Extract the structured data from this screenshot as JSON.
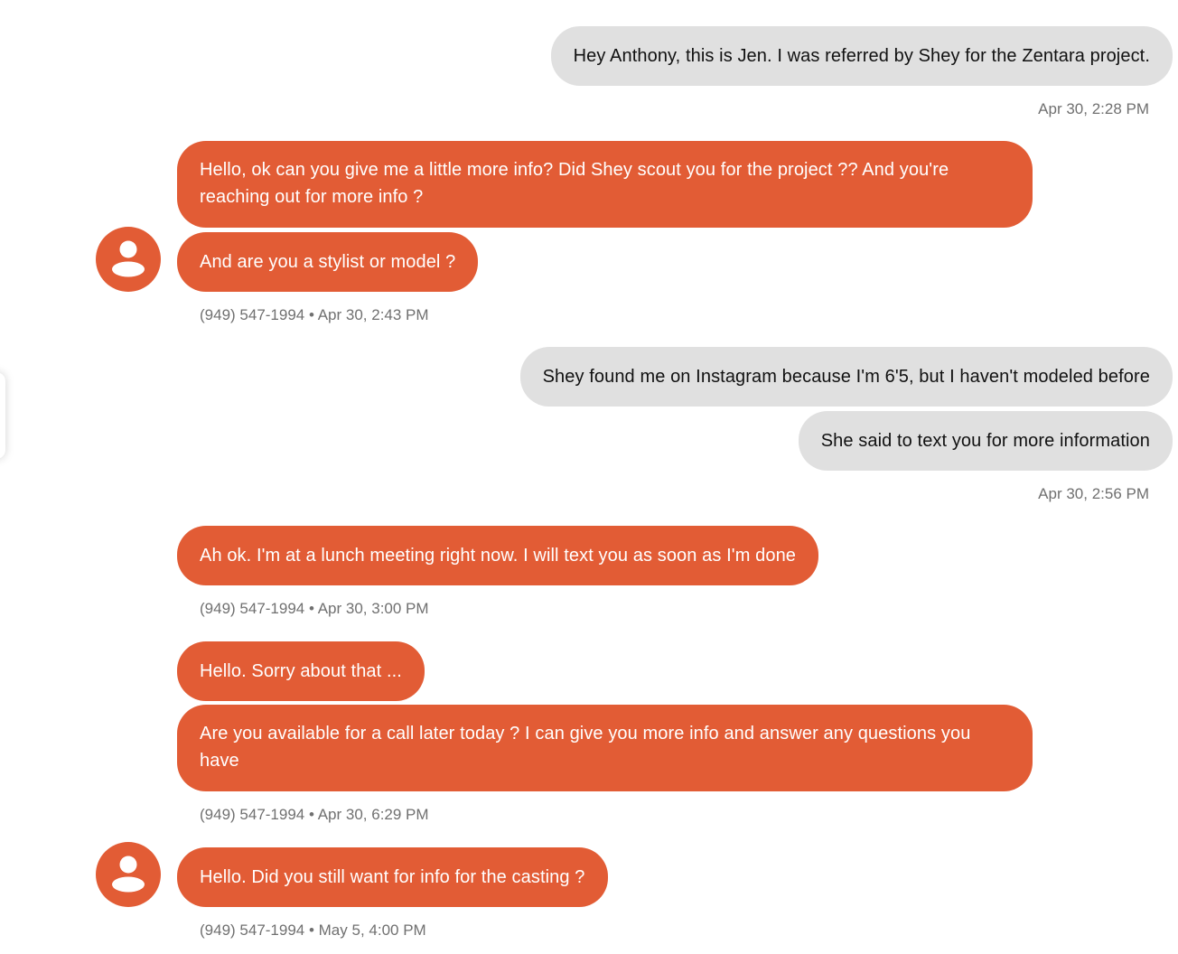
{
  "conversation": {
    "messages": [
      {
        "direction": "outgoing",
        "text": "Hey Anthony, this is Jen. I was referred by Shey for the Zentara project."
      },
      {
        "direction": "incoming",
        "text": "Hello, ok can you give me a little more info? Did Shey scout you for the project ?? And you're reaching out for more info ?"
      },
      {
        "direction": "incoming",
        "text": "And are you a stylist or model ?"
      },
      {
        "direction": "outgoing",
        "text": "Shey found me on Instagram because I'm 6'5, but I haven't modeled before"
      },
      {
        "direction": "outgoing",
        "text": "She said to text you for more information"
      },
      {
        "direction": "incoming",
        "text": "Ah ok. I'm at a lunch meeting right now. I will text you as soon as I'm done"
      },
      {
        "direction": "incoming",
        "text": "Hello. Sorry about that ..."
      },
      {
        "direction": "incoming",
        "text": "Are you available for a call later today ? I can give you more info and answer any questions you have"
      },
      {
        "direction": "incoming",
        "text": "Hello. Did you still want for info for the casting ?"
      }
    ],
    "timestamps": [
      "Apr 30, 2:28 PM",
      "(949) 547-1994 • Apr 30, 2:43 PM",
      "Apr 30, 2:56 PM",
      "(949) 547-1994 • Apr 30, 3:00 PM",
      "(949) 547-1994 • Apr 30, 6:29 PM",
      "(949) 547-1994 • May 5, 4:00 PM"
    ],
    "avatar_icon": "person-icon"
  },
  "colors": {
    "incoming_bubble": "#e25c35",
    "outgoing_bubble": "#e0e0e0",
    "meta_text": "#707070"
  }
}
